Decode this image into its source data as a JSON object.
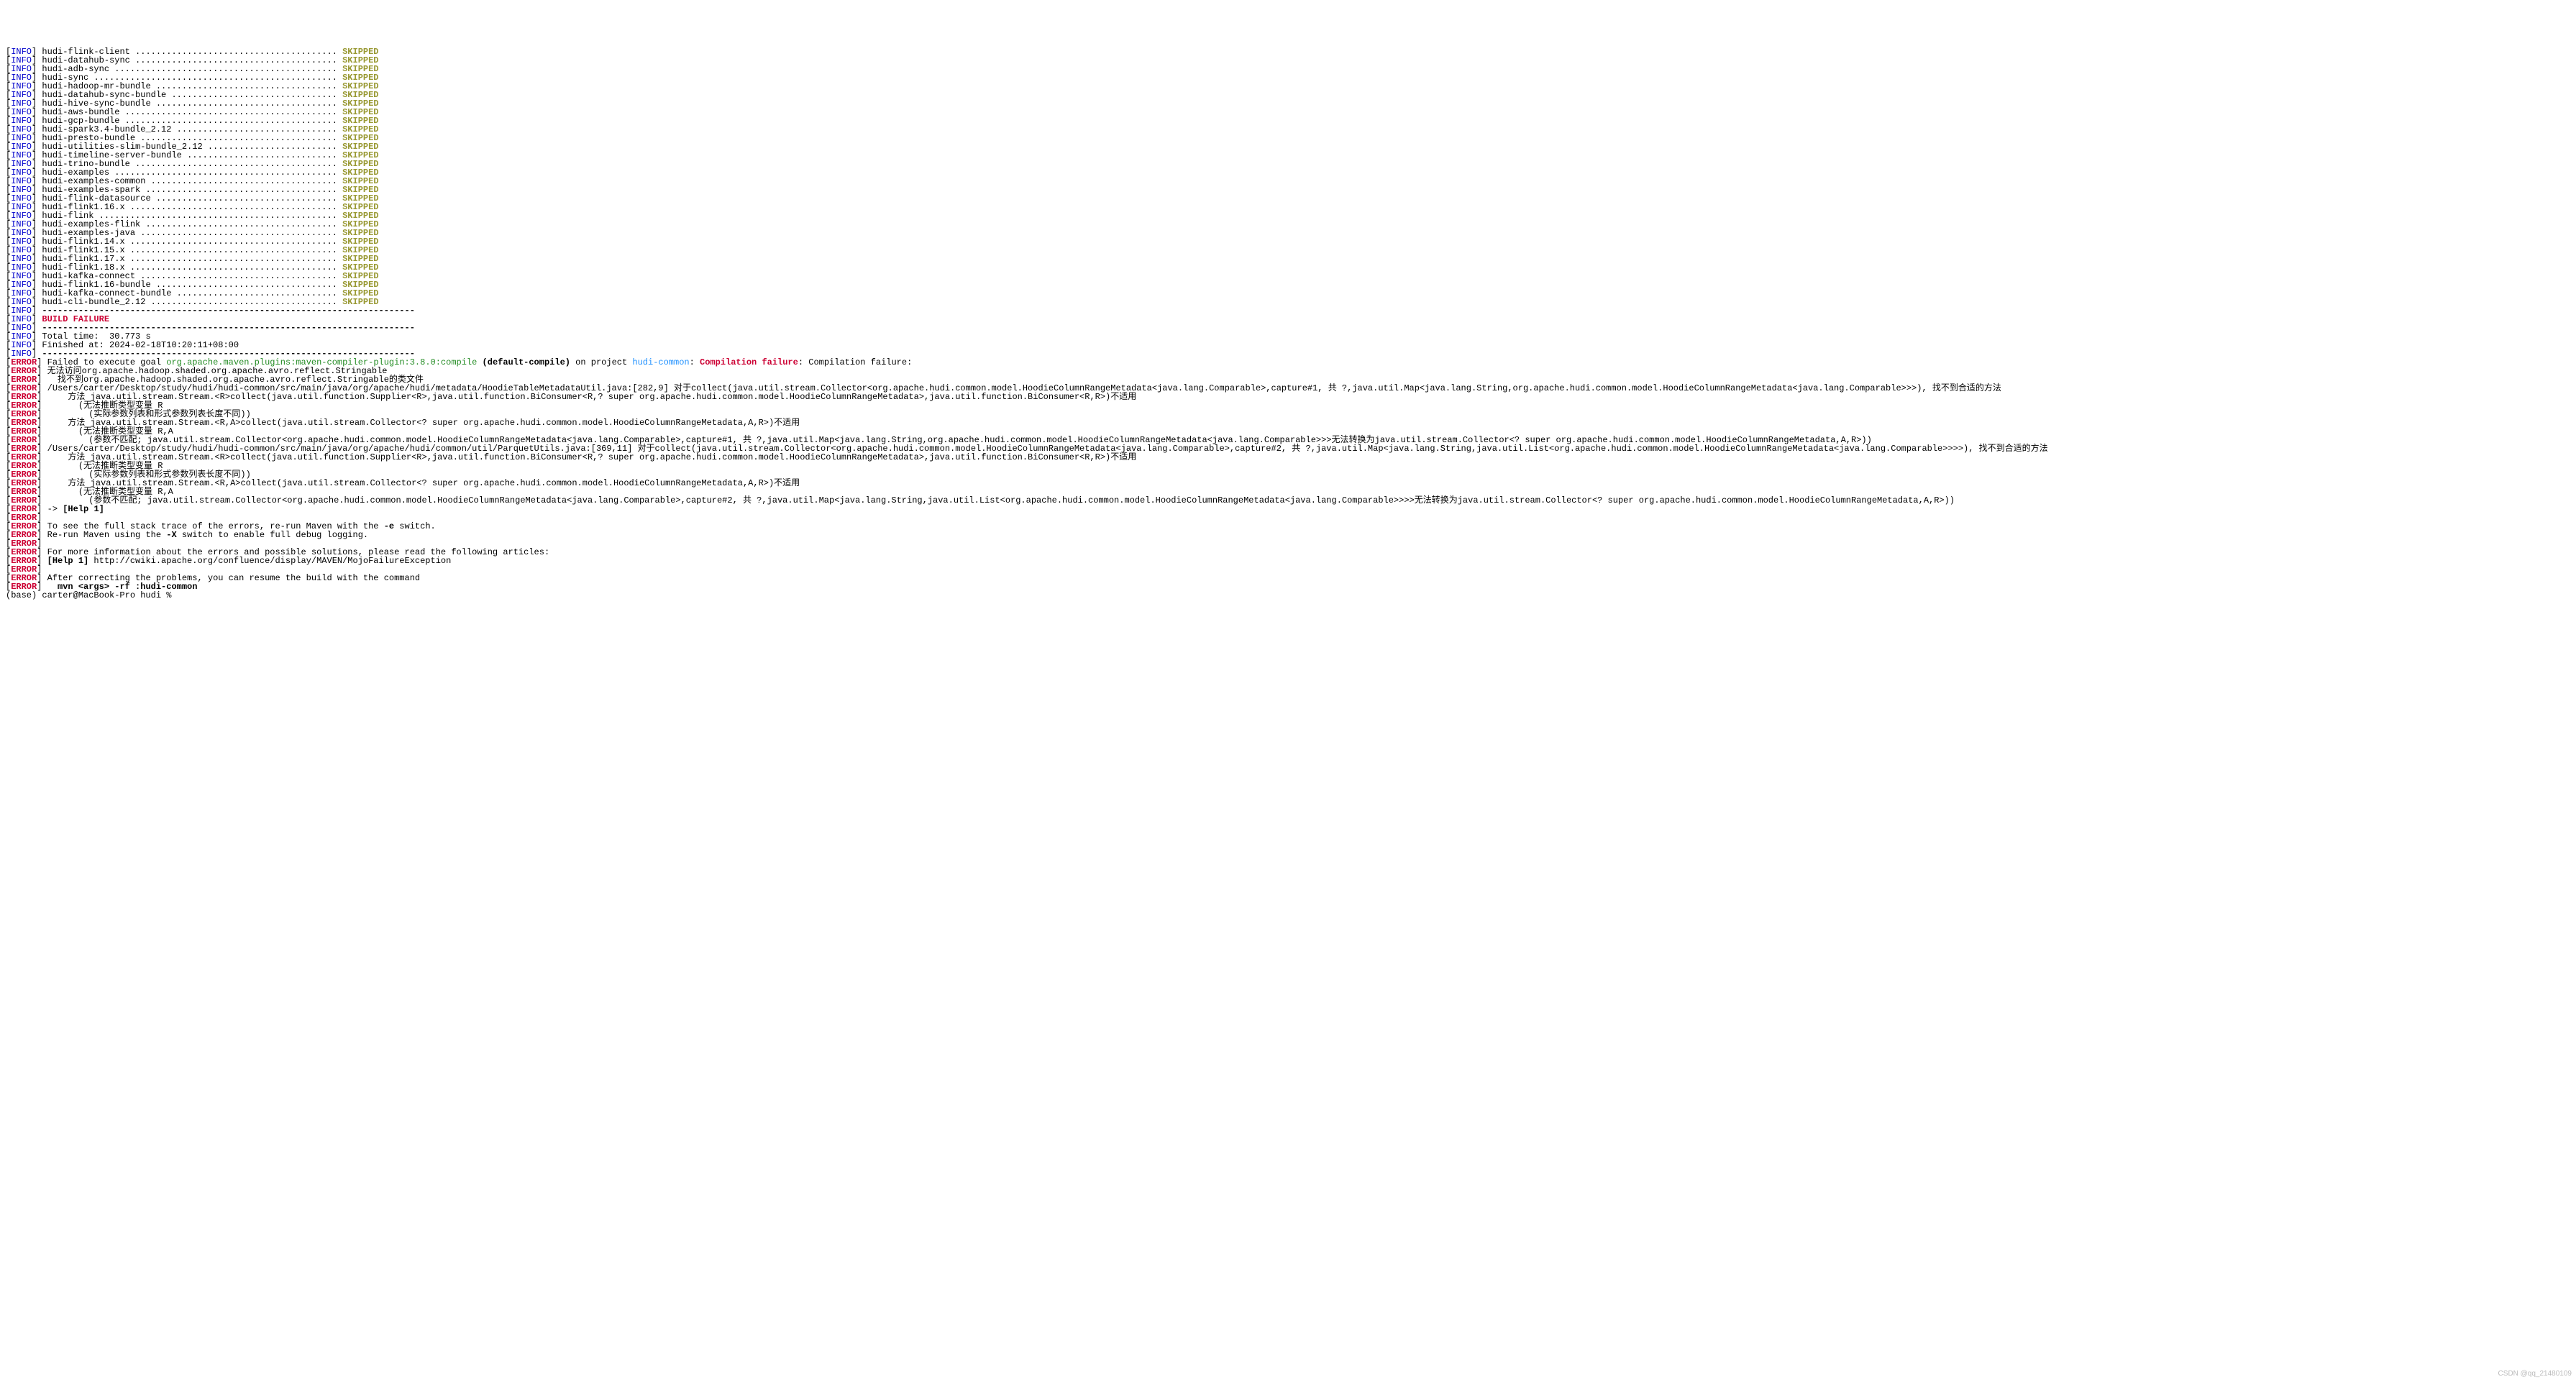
{
  "dots_target_col": 64,
  "skipped_label": "SKIPPED",
  "info_label": "INFO",
  "error_label": "ERROR",
  "separator": "------------------------------------------------------------------------",
  "modules": [
    "hudi-flink-client",
    "hudi-datahub-sync",
    "hudi-adb-sync",
    "hudi-sync",
    "hudi-hadoop-mr-bundle",
    "hudi-datahub-sync-bundle",
    "hudi-hive-sync-bundle",
    "hudi-aws-bundle",
    "hudi-gcp-bundle",
    "hudi-spark3.4-bundle_2.12",
    "hudi-presto-bundle",
    "hudi-utilities-slim-bundle_2.12",
    "hudi-timeline-server-bundle",
    "hudi-trino-bundle",
    "hudi-examples",
    "hudi-examples-common",
    "hudi-examples-spark",
    "hudi-flink-datasource",
    "hudi-flink1.16.x",
    "hudi-flink",
    "hudi-examples-flink",
    "hudi-examples-java",
    "hudi-flink1.14.x",
    "hudi-flink1.15.x",
    "hudi-flink1.17.x",
    "hudi-flink1.18.x",
    "hudi-kafka-connect",
    "hudi-flink1.16-bundle",
    "hudi-kafka-connect-bundle",
    "hudi-cli-bundle_2.12"
  ],
  "build_failure": "BUILD FAILURE",
  "total_time": "Total time:  30.773 s",
  "finished_at": "Finished at: 2024-02-18T10:20:11+08:00",
  "goal_prefix": "Failed to execute goal ",
  "goal_plugin": "org.apache.maven.plugins:maven-compiler-plugin:3.8.0:compile",
  "goal_default": " (default-compile)",
  "goal_on_project": " on project ",
  "goal_project": "hudi-common",
  "goal_colon": ": ",
  "goal_compfail": "Compilation failure",
  "goal_tail": ": Compilation failure:",
  "error_lines": [
    "无法访问org.apache.hadoop.shaded.org.apache.avro.reflect.Stringable",
    "  找不到org.apache.hadoop.shaded.org.apache.avro.reflect.Stringable的类文件",
    "/Users/carter/Desktop/study/hudi/hudi-common/src/main/java/org/apache/hudi/metadata/HoodieTableMetadataUtil.java:[282,9] 对于collect(java.util.stream.Collector<org.apache.hudi.common.model.HoodieColumnRangeMetadata<java.lang.Comparable>,capture#1, 共 ?,java.util.Map<java.lang.String,org.apache.hudi.common.model.HoodieColumnRangeMetadata<java.lang.Comparable>>>), 找不到合适的方法",
    "    方法 java.util.stream.Stream.<R>collect(java.util.function.Supplier<R>,java.util.function.BiConsumer<R,? super org.apache.hudi.common.model.HoodieColumnRangeMetadata>,java.util.function.BiConsumer<R,R>)不适用",
    "      (无法推断类型变量 R",
    "        (实际参数列表和形式参数列表长度不同))",
    "    方法 java.util.stream.Stream.<R,A>collect(java.util.stream.Collector<? super org.apache.hudi.common.model.HoodieColumnRangeMetadata,A,R>)不适用",
    "      (无法推断类型变量 R,A",
    "        (参数不匹配; java.util.stream.Collector<org.apache.hudi.common.model.HoodieColumnRangeMetadata<java.lang.Comparable>,capture#1, 共 ?,java.util.Map<java.lang.String,org.apache.hudi.common.model.HoodieColumnRangeMetadata<java.lang.Comparable>>>无法转换为java.util.stream.Collector<? super org.apache.hudi.common.model.HoodieColumnRangeMetadata,A,R>))",
    "/Users/carter/Desktop/study/hudi/hudi-common/src/main/java/org/apache/hudi/common/util/ParquetUtils.java:[369,11] 对于collect(java.util.stream.Collector<org.apache.hudi.common.model.HoodieColumnRangeMetadata<java.lang.Comparable>,capture#2, 共 ?,java.util.Map<java.lang.String,java.util.List<org.apache.hudi.common.model.HoodieColumnRangeMetadata<java.lang.Comparable>>>>), 找不到合适的方法",
    "    方法 java.util.stream.Stream.<R>collect(java.util.function.Supplier<R>,java.util.function.BiConsumer<R,? super org.apache.hudi.common.model.HoodieColumnRangeMetadata>,java.util.function.BiConsumer<R,R>)不适用",
    "      (无法推断类型变量 R",
    "        (实际参数列表和形式参数列表长度不同))",
    "    方法 java.util.stream.Stream.<R,A>collect(java.util.stream.Collector<? super org.apache.hudi.common.model.HoodieColumnRangeMetadata,A,R>)不适用",
    "      (无法推断类型变量 R,A",
    "        (参数不匹配; java.util.stream.Collector<org.apache.hudi.common.model.HoodieColumnRangeMetadata<java.lang.Comparable>,capture#2, 共 ?,java.util.Map<java.lang.String,java.util.List<org.apache.hudi.common.model.HoodieColumnRangeMetadata<java.lang.Comparable>>>>无法转换为java.util.stream.Collector<? super org.apache.hudi.common.model.HoodieColumnRangeMetadata,A,R>))"
  ],
  "help_arrow": "-> ",
  "help1": "[Help 1]",
  "blank": "",
  "stacktrace_hint_pre": "To see the full stack trace of the errors, re-run Maven with the ",
  "stacktrace_flag": "-e",
  "stacktrace_hint_post": " switch.",
  "rerun_hint_pre": "Re-run Maven using the ",
  "rerun_flag": "-X",
  "rerun_hint_post": " switch to enable full debug logging.",
  "more_info": "For more information about the errors and possible solutions, please read the following articles:",
  "help_link_label": "[Help 1]",
  "help_link_url": " http://cwiki.apache.org/confluence/display/MAVEN/MojoFailureException",
  "after_correcting": "After correcting the problems, you can resume the build with the command",
  "resume_cmd": "  mvn <args> -rf :hudi-common",
  "prompt": "(base) carter@MacBook-Pro hudi % ",
  "watermark": "CSDN @qq_21480109"
}
